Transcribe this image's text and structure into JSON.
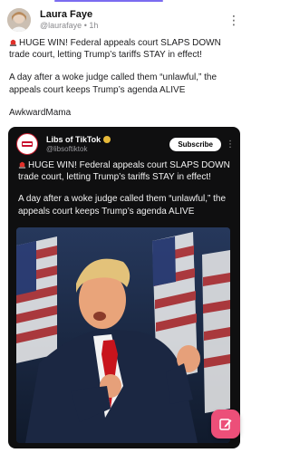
{
  "post": {
    "author_name": "Laura Faye",
    "handle": "@laurafaye",
    "separator": "•",
    "time": "1h",
    "more_label": "⋮",
    "line1": "HUGE WIN! Federal appeals court SLAPS DOWN trade court, letting Trump’s tariffs STAY in effect!",
    "line2": "A day after a woke judge called them “unlawful,” the appeals court keeps Trump’s agenda ALIVE",
    "line3": "AwkwardMama"
  },
  "embed": {
    "author_name": "Libs of TikTok",
    "handle": "@libsoftiktok",
    "subscribe_label": "Subscribe",
    "more_label": "⋮",
    "line1": "HUGE WIN! Federal appeals court SLAPS DOWN trade court, letting Trump’s tariffs STAY in effect!",
    "line2": "A day after a woke judge called them “unlawful,” the appeals court keeps Trump’s agenda ALIVE"
  },
  "icons": {
    "siren": "siren-emoji-icon",
    "verified": "verified-badge-icon",
    "compose": "compose-icon"
  },
  "colors": {
    "accent": "#7b6cf0",
    "fab": "#ec4f79",
    "embed_bg": "#0f0f10"
  }
}
